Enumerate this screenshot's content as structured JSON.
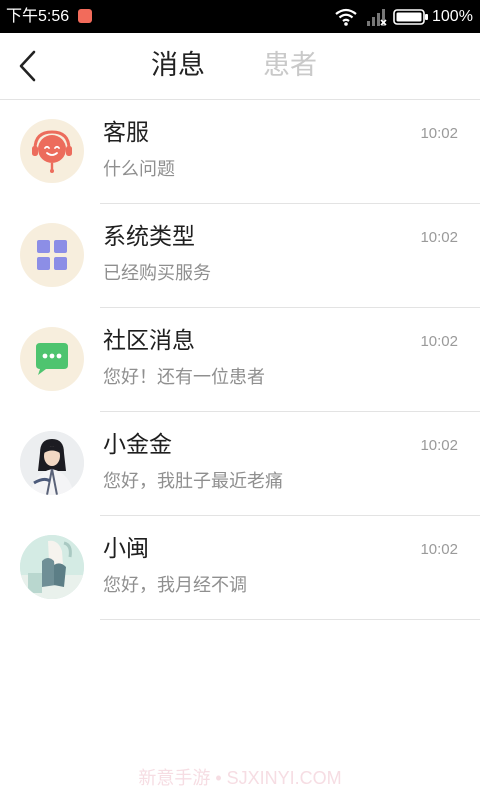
{
  "status_bar": {
    "time": "下午5:56",
    "battery": "100%",
    "icons": [
      "notification-icon",
      "wifi-icon",
      "signal-icon",
      "battery-icon"
    ]
  },
  "header": {
    "back_icon": "chevron-left-icon",
    "tabs": [
      {
        "label": "消息",
        "active": true
      },
      {
        "label": "患者",
        "active": false
      }
    ],
    "active_color": "#222222",
    "inactive_color": "#c9c9c9"
  },
  "messages": [
    {
      "name": "客服",
      "preview": "什么问题",
      "time": "10:02",
      "avatar": "customer-service-icon"
    },
    {
      "name": "系统类型",
      "preview": "已经购买服务",
      "time": "10:02",
      "avatar": "grid-apps-icon"
    },
    {
      "name": "社区消息",
      "preview": "您好！还有一位患者",
      "time": "10:02",
      "avatar": "chat-bubble-icon"
    },
    {
      "name": "小金金",
      "preview": "您好，我肚子最近老痛",
      "time": "10:02",
      "avatar": "user-photo-avatar"
    },
    {
      "name": "小闽",
      "preview": "您好，我月经不调",
      "time": "10:02",
      "avatar": "user-photo-avatar"
    }
  ],
  "watermark": "新意手游 • SJXINYI.COM",
  "colors": {
    "avatar_bg": "#f7eedd",
    "service_red": "#ec6c5c",
    "grid_purple": "#8c8ee6",
    "chat_green": "#4ec46f"
  }
}
